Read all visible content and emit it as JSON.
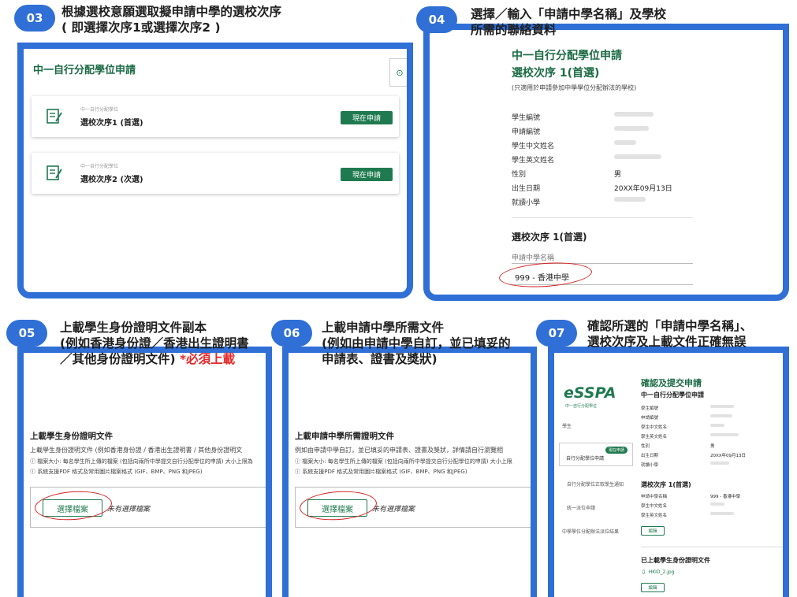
{
  "steps": {
    "s03": {
      "badge": "03",
      "title": "根據選校意願選取擬申請中學的選校次序\n( 即選擇次序1或選擇次序2 )",
      "heading": "中一自行分配學位申請",
      "cards": [
        {
          "small": "中一自行分配學位",
          "label": "選校次序1 (首選)",
          "button": "現在申請"
        },
        {
          "small": "中一自行分配學位",
          "label": "選校次序2 (次選)",
          "button": "現在申請"
        }
      ],
      "side_icon": "⊙"
    },
    "s04": {
      "badge": "04",
      "title": "選擇／輸入「申請中學名稱」及學校\n所需的聯絡資料",
      "heading1": "中一自行分配學位申請",
      "heading2": "選校次序 1(首選)",
      "note": "(只適用於申請參加中學學位分配辦法的學校)",
      "fields": [
        {
          "label": "學生編號",
          "value": ""
        },
        {
          "label": "申請編號",
          "value": ""
        },
        {
          "label": "學生中文姓名",
          "value": ""
        },
        {
          "label": "學生英文姓名",
          "value": ""
        },
        {
          "label": "性別",
          "value": "男"
        },
        {
          "label": "出生日期",
          "value": "20XX年09月13日"
        },
        {
          "label": "就讀小學",
          "value": ""
        }
      ],
      "section": "選校次序 1(首選)",
      "school_label": "申請中學名稱",
      "school_value": "999 - 香港中學"
    },
    "s05": {
      "badge": "05",
      "title_pre": "上載學生身份證明文件副本\n(例如香港身份證／香港出生證明書\n／其他身份證明文件) ",
      "title_req": "*必須上載",
      "heading": "上載學生身份證明文件",
      "desc": "上載學生身份證明文件 (例如香港身份證 / 香港出生證明書 / 其他身份證明文",
      "info1": "ⓘ 檔案大小: 每名學生所上傳的檔案 (包括向兩所中學提交自行分配學位的申請) 大小上限為",
      "info2": "ⓘ 系統支援PDF 格式及常用圖片檔案格式 (GIF、BMP、PNG 和JPEG)",
      "button": "選擇檔案",
      "nofile": "未有選擇檔案"
    },
    "s06": {
      "badge": "06",
      "title": "上載申請中學所需文件\n(例如由申請中學自訂，並已填妥的\n申請表、證書及獎狀)",
      "heading": "上載申請中學所需證明文件",
      "desc": "例如由申請中學自訂，並已填妥的申請表、證書及獎狀，詳情請自行瀏覽相",
      "info1": "ⓘ 檔案大小: 每名學生所上傳的檔案 (包括向兩所中學提交自行分配學位的申請) 大小上限",
      "info2": "ⓘ 系統支援PDF 格式及常用圖片檔案格式 (GIF、BMP、PNG 和JPEG)",
      "button": "選擇檔案",
      "nofile": "未有選擇檔案"
    },
    "s07": {
      "badge": "07",
      "title": "確認所選的「申請中學名稱」、\n選校次序及上載文件正確無誤",
      "logo": "eSSPA",
      "logo_sub": "中一自行分配學位",
      "nav": [
        {
          "label": "學生",
          "badge": ""
        },
        {
          "label": "自行分配學位申請",
          "badge": "現在申請"
        },
        {
          "label": "自行分配學位正取學生通知",
          "badge": ""
        },
        {
          "label": "統一派位申請",
          "badge": ""
        },
        {
          "label": "中學學位分配辦法派位結果",
          "badge": ""
        }
      ],
      "heading": "確認及提交申請",
      "subheading": "中一自行分配學位申請",
      "fields": [
        {
          "label": "學生編號",
          "value": ""
        },
        {
          "label": "申請編號",
          "value": ""
        },
        {
          "label": "學生中文姓名",
          "value": ""
        },
        {
          "label": "學生英文姓名",
          "value": ""
        },
        {
          "label": "性別",
          "value": "男"
        },
        {
          "label": "出生日期",
          "value": "20XX年09月13日"
        },
        {
          "label": "就讀小學",
          "value": ""
        }
      ],
      "section1": "選校次序 1(首選)",
      "fields2": [
        {
          "label": "申請中學名稱",
          "value": "999 - 香港中學"
        },
        {
          "label": "學生中文姓名",
          "value": ""
        },
        {
          "label": "學生英文姓名",
          "value": ""
        }
      ],
      "edit1": "編輯",
      "section2": "已上載學生身份證明文件",
      "file": "HKID_2.jpg",
      "edit2": "編輯"
    }
  }
}
